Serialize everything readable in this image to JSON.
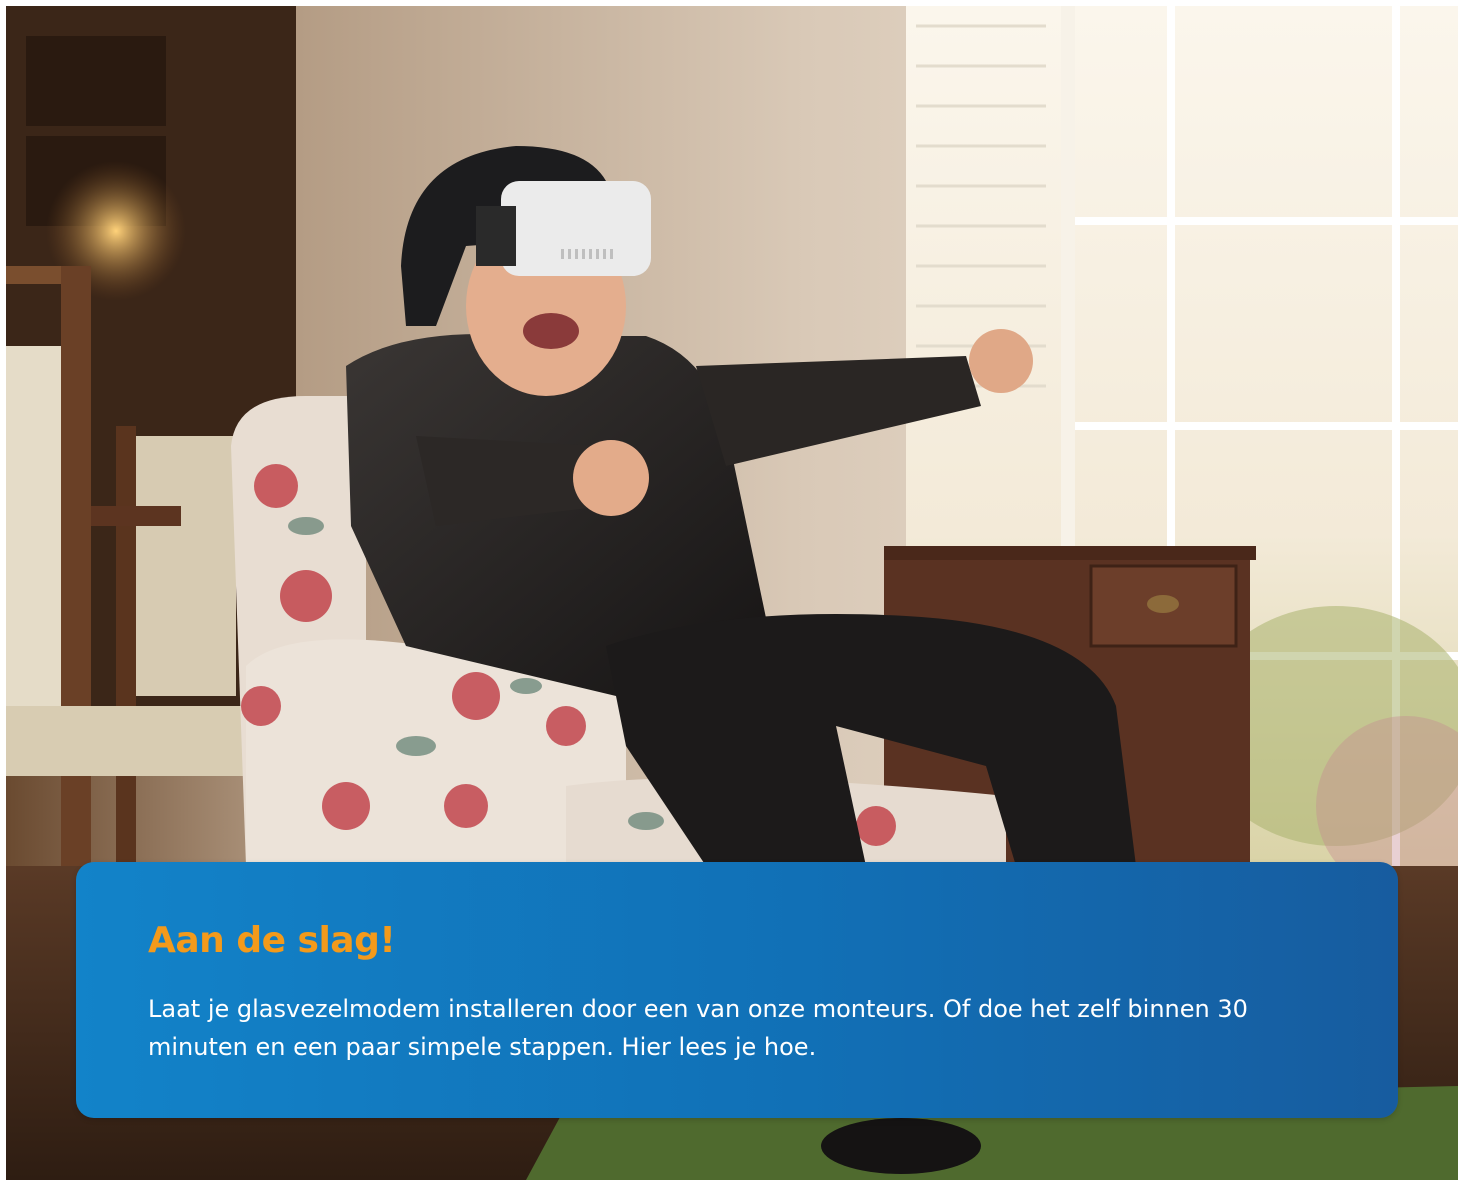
{
  "photo": {
    "subject": "senior-in-vr-headset-armchair"
  },
  "card": {
    "title": "Aan de slag!",
    "body": "Laat je glasvezelmodem installeren door een van onze monteurs. Of doe het zelf binnen 30 minuten en een paar simpele stappen. Hier lees je hoe.",
    "title_color": "#f39a1b",
    "background_color": "#1283c9"
  }
}
